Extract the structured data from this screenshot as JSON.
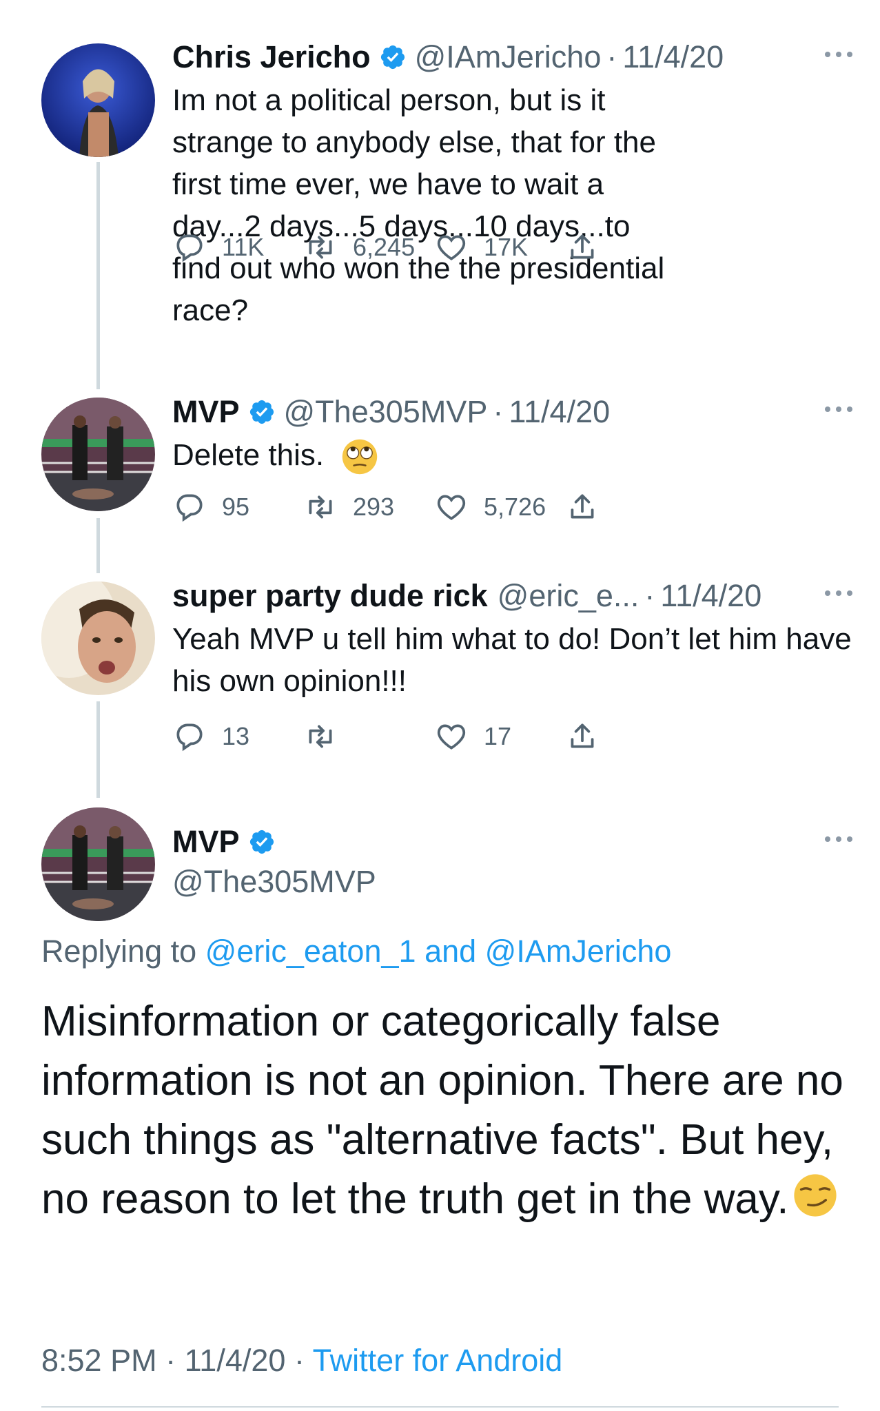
{
  "colors": {
    "accent": "#1d9bf0",
    "secondary_text": "#536471",
    "primary_text": "#0f1419",
    "thread_line": "#cfd9de"
  },
  "tweets": [
    {
      "name": "Chris Jericho",
      "handle": "@IAmJericho",
      "separator": "·",
      "date": "11/4/20",
      "text": "Im not a political person, but is it strange to anybody else, that for the first time ever, we have to wait a day...2 days...5 days...10 days...to find out who won the the presidential race?",
      "replies": "11K",
      "retweets": "6,245",
      "likes": "17K",
      "avatar": "wrestler-portrait"
    },
    {
      "name": "MVP",
      "handle": "@The305MVP",
      "separator": "·",
      "date": "11/4/20",
      "text": "Delete this.",
      "emoji": "face-with-rolling-eyes",
      "replies": "95",
      "retweets": "293",
      "likes": "5,726",
      "avatar": "wrestling-ring"
    },
    {
      "name": "super party dude rick",
      "handle": "@eric_e...",
      "separator": "·",
      "date": "11/4/20",
      "text": "Yeah MVP u tell him what to do! Don’t let him have his own opinion!!!",
      "replies": "13",
      "retweets": "",
      "likes": "17",
      "avatar": "selfie"
    }
  ],
  "main_tweet": {
    "name": "MVP",
    "handle": "@The305MVP",
    "replying_prefix": "Replying to",
    "mention_1": "@eric_eaton_1",
    "mention_joiner": "and",
    "mention_2": "@IAmJericho",
    "text": "Misinformation or categorically false information is not an opinion. There are no such things as \"alternative facts\". But hey, no reason to let the truth get in the way.",
    "emoji": "smirking-face",
    "time": "8:52 PM",
    "separator": "·",
    "date": "11/4/20",
    "client": "Twitter for Android"
  }
}
